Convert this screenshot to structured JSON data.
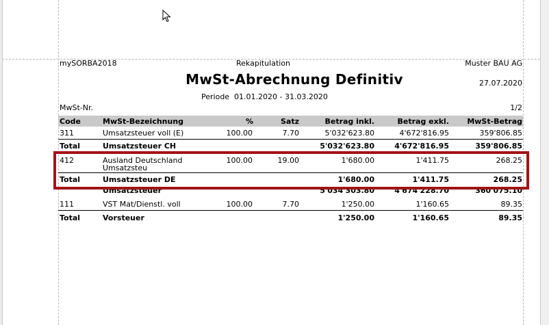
{
  "report": {
    "app_name": "mySORBA2018",
    "report_type": "Rekapitulation",
    "company": "Muster BAU AG",
    "title": "MwSt-Abrechnung Definitiv",
    "date": "27.07.2020",
    "period_label": "Periode",
    "period_value": "01.01.2020 - 31.03.2020",
    "vat_no_label": "MwSt-Nr.",
    "page": "1/2"
  },
  "table": {
    "headers": {
      "code": "Code",
      "desc": "MwSt-Bezeichnung",
      "pct": "%",
      "rate": "Satz",
      "incl": "Betrag inkl.",
      "excl": "Betrag exkl.",
      "vat": "MwSt-Betrag"
    },
    "rows": [
      {
        "code": "311",
        "desc": "Umsatzsteuer voll (E)",
        "pct": "100.00",
        "rate": "7.70",
        "incl": "5'032'623.80",
        "excl": "4'672'816.95",
        "vat": "359'806.85"
      },
      {
        "code": "Total",
        "desc": "Umsatzsteuer CH",
        "incl": "5'032'623.80",
        "excl": "4'672'816.95",
        "vat": "359'806.85"
      },
      {
        "code": "412",
        "desc": "Ausland Deutschland",
        "desc2": "Umsatzsteu",
        "pct": "100.00",
        "rate": "19.00",
        "incl": "1'680.00",
        "excl": "1'411.75",
        "vat": "268.25"
      },
      {
        "code": "Total",
        "desc": "Umsatzsteuer DE",
        "incl": "1'680.00",
        "excl": "1'411.75",
        "vat": "268.25"
      },
      {
        "desc": "Umsatzsteuer",
        "incl": "5'034'303.80",
        "excl": "4'674'228.70",
        "vat": "360'075.10"
      },
      {
        "code": "111",
        "desc": "VST Mat/Dienstl. voll",
        "pct": "100.00",
        "rate": "7.70",
        "incl": "1'250.00",
        "excl": "1'160.65",
        "vat": "89.35"
      },
      {
        "code": "Total",
        "desc": "Vorsteuer",
        "incl": "1'250.00",
        "excl": "1'160.65",
        "vat": "89.35"
      }
    ]
  },
  "colors": {
    "highlight_border": "#a01515",
    "header_bg": "#c9c9c9"
  },
  "icons": {
    "cursor": "mouse-pointer-icon"
  }
}
